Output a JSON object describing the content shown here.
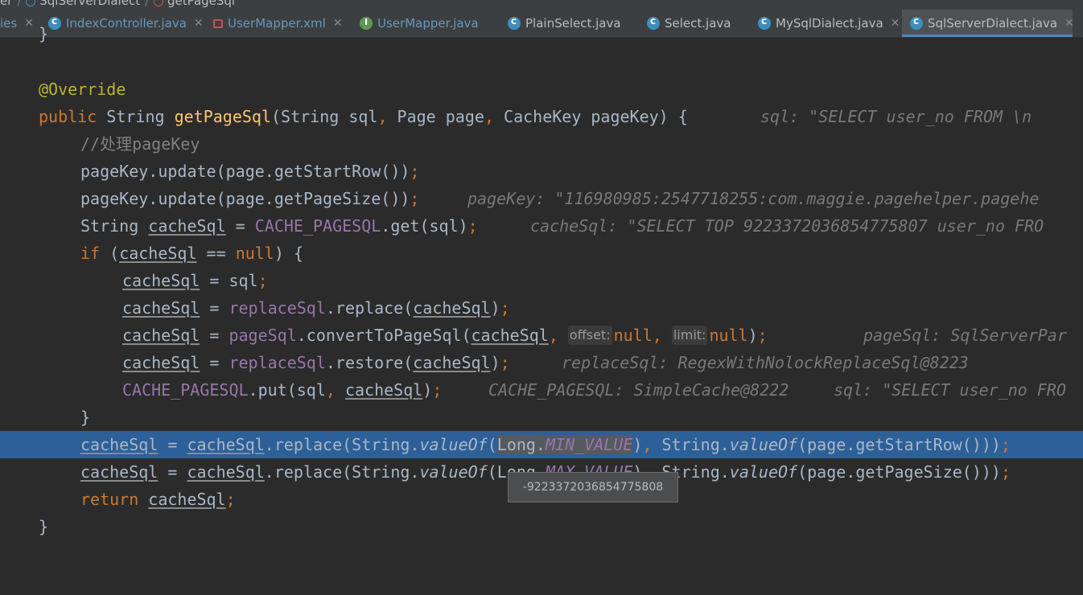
{
  "breadcrumb": {
    "items": [
      "er",
      "SqlServerDialect",
      "getPageSql"
    ]
  },
  "tabs": [
    {
      "label": "ies",
      "icon": "none",
      "active": false
    },
    {
      "label": "IndexController.java",
      "icon": "class-icon",
      "active": false
    },
    {
      "label": "UserMapper.xml",
      "icon": "xml-icon",
      "active": false
    },
    {
      "label": "UserMapper.java",
      "icon": "interface-icon",
      "active": false
    },
    {
      "label": "PlainSelect.java",
      "icon": "class-icon",
      "active": false
    },
    {
      "label": "Select.java",
      "icon": "class-icon",
      "active": false
    },
    {
      "label": "MySqlDialect.java",
      "icon": "class-icon",
      "active": false
    },
    {
      "label": "SqlServerDialect.java",
      "icon": "class-icon",
      "active": true
    }
  ],
  "code": {
    "l0": "}",
    "l1": "@Override",
    "l2": {
      "public": "public",
      "type": "String",
      "name": "getPageSql",
      "params_a": "(String sql",
      "comma1": ",",
      "params_b": " Page page",
      "comma2": ",",
      "params_c": " CacheKey pageKey) {",
      "hint": "sql: \"SELECT user_no FROM \\n"
    },
    "l3": "//处理pageKey",
    "l4": {
      "text": "pageKey.update(page.getStartRow())",
      "semi": ";"
    },
    "l5": {
      "text": "pageKey.update(page.getPageSize())",
      "semi": ";",
      "hint": "pageKey: \"116980985:2547718255:com.maggie.pagehelper.pagehe"
    },
    "l6": {
      "type": "String ",
      "var": "cacheSql",
      "eq": " = ",
      "fld": "CACHE_PAGESQL",
      "rest": ".get(sql)",
      "semi": ";",
      "hint": "cacheSql: \"SELECT TOP 9223372036854775807 user_no FRO"
    },
    "l7": {
      "kw": "if",
      "open": " (",
      "var": "cacheSql",
      "op": " == ",
      "nul": "null",
      "close": ") {"
    },
    "l8": {
      "var": "cacheSql",
      "eq": " = ",
      "rest": "sql",
      "semi": ";"
    },
    "l9": {
      "var": "cacheSql",
      "eq": " = ",
      "fld": "replaceSql",
      "rest": ".replace(",
      "arg": "cacheSql",
      "end": ")",
      "semi": ";"
    },
    "l10": {
      "var": "cacheSql",
      "eq": " = ",
      "fld": "pageSql",
      "rest": ".convertToPageSql(",
      "arg": "cacheSql",
      "c1": ",",
      "p1": "offset:",
      "n1": "null",
      "c2": ",",
      "p2": "limit:",
      "n2": "null",
      "end": ")",
      "semi": ";",
      "hint": "pageSql: SqlServerPar"
    },
    "l11": {
      "var": "cacheSql",
      "eq": " = ",
      "fld": "replaceSql",
      "rest": ".restore(",
      "arg": "cacheSql",
      "end": ")",
      "semi": ";",
      "hint": "replaceSql: RegexWithNolockReplaceSql@8223"
    },
    "l12": {
      "fld": "CACHE_PAGESQL",
      "rest": ".put(sql",
      "comma": ",",
      "arg": "cacheSql",
      "end": ")",
      "semi": ";",
      "hint1": "CACHE_PAGESQL: SimpleCache@8222",
      "hint2": "sql: \"SELECT user_no FRO"
    },
    "l13": "}",
    "l14": {
      "var": "cacheSql",
      "eq": " = ",
      "var2": "cacheSql",
      "rest": ".replace(String.",
      "fn": "valueOf",
      "open": "(",
      "sel_cls": "Long.",
      "sel_fld": "MIN_VALUE",
      "close": ")",
      "comma": ",",
      "rest2": " String.",
      "fn2": "valueOf",
      "tail": "(page.getStartRow()))",
      "semi": ";"
    },
    "l15": {
      "var": "cacheSql",
      "eq": " = ",
      "var2": "cacheSql",
      "rest": ".replace(String.",
      "fn": "valueOf",
      "open": "(",
      "cls": "Long.",
      "fld": "MAX_VALUE",
      "close": ")",
      "comma": ",",
      "rest2": " String.",
      "fn2": "valueOf",
      "tail": "(page.getPageSize()))",
      "semi": ";"
    },
    "l16": {
      "kw": "return",
      "var": "cacheSql",
      "semi": ";"
    },
    "l17": "}"
  },
  "tooltip": {
    "value": "-9223372036854775808"
  },
  "colors": {
    "background": "#2b2b2b",
    "current_line": "#2d6099",
    "keyword": "#cc7832",
    "annotation": "#bbb529",
    "method": "#ffc66d",
    "field": "#9876aa",
    "comment": "#808080",
    "text": "#a9b7c6"
  }
}
